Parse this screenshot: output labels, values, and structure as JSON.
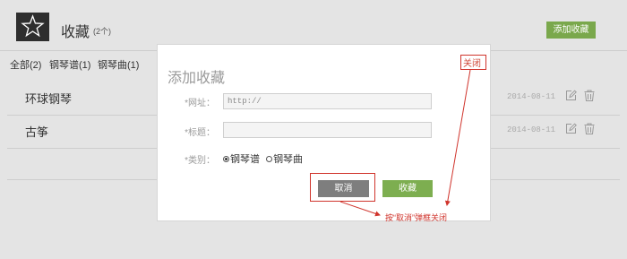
{
  "header": {
    "title": "收藏",
    "count": "(2个)",
    "add_button": "添加收藏"
  },
  "filters": [
    {
      "label": "全部(2)"
    },
    {
      "label": "钢琴谱(1)"
    },
    {
      "label": "钢琴曲(1)"
    }
  ],
  "items": [
    {
      "title": "环球钢琴",
      "date": "2014-08-11",
      "icons": [
        "edit-icon",
        "trash-icon"
      ]
    },
    {
      "title": "古筝",
      "date": "2014-08-11",
      "icons": [
        "edit-icon",
        "trash-icon"
      ]
    }
  ],
  "modal": {
    "title": "添加收藏",
    "close": "关闭",
    "url_label": "*网址：",
    "url_placeholder": "http://",
    "title_label": "*标题：",
    "title_value": "",
    "category_label": "*类别：",
    "categories": [
      {
        "label": "钢琴谱",
        "selected": true
      },
      {
        "label": "钢琴曲",
        "selected": false
      }
    ],
    "cancel": "取消",
    "submit": "收藏"
  },
  "annotation": {
    "text": "按“取消”弹框关闭"
  },
  "colors": {
    "accent_green": "#7aa84c",
    "dark": "#2e2e2e",
    "annotation_red": "#d0342c"
  }
}
